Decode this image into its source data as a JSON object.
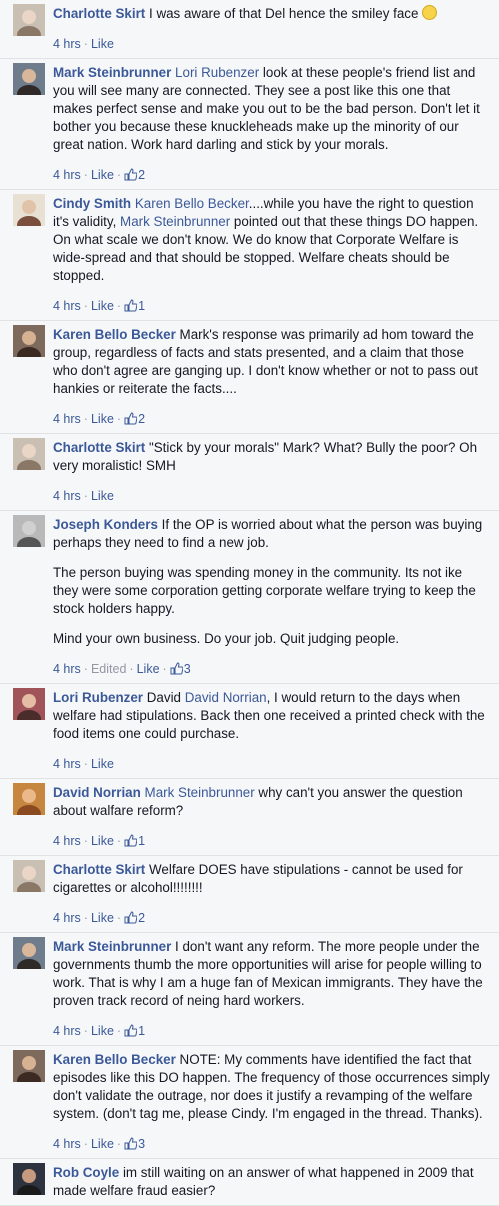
{
  "meta_labels": {
    "like": "Like",
    "separator": "·"
  },
  "comments": [
    {
      "author": "Charlotte Skirt",
      "avatar": "charlotte-avatar",
      "segments": [
        {
          "t": "text",
          "v": "I was aware of that Del hence the smiley face "
        },
        {
          "t": "emoji",
          "v": "smiley"
        }
      ],
      "time": "4 hrs",
      "edited": null,
      "likes": null
    },
    {
      "author": "Mark Steinbrunner",
      "avatar": "mark-avatar",
      "segments": [
        {
          "t": "mention",
          "v": "Lori Rubenzer"
        },
        {
          "t": "text",
          "v": " look at these people's friend list and you will see many are connected. They see a post like this one that makes perfect sense and make you out to be the bad person. Don't let it bother you because these knuckleheads make up the minority of our great nation. Work hard darling and stick by your morals."
        }
      ],
      "time": "4 hrs",
      "edited": null,
      "likes": "2"
    },
    {
      "author": "Cindy Smith",
      "avatar": "cindy-avatar",
      "segments": [
        {
          "t": "mention",
          "v": "Karen Bello Becker"
        },
        {
          "t": "text",
          "v": "....while you have the right to question it's validity, "
        },
        {
          "t": "mention",
          "v": "Mark Steinbrunner"
        },
        {
          "t": "text",
          "v": " pointed out that these things DO happen. On what scale we don't know. We do know that Corporate Welfare is wide-spread and that should be stopped. Welfare cheats should be stopped."
        }
      ],
      "time": "4 hrs",
      "edited": null,
      "likes": "1"
    },
    {
      "author": "Karen Bello Becker",
      "avatar": "karen-avatar",
      "segments": [
        {
          "t": "text",
          "v": "Mark's response was primarily ad hom toward the group, regardless of facts and stats presented, and a claim that those who don't agree are ganging up. I don't know whether or not to pass out hankies or reiterate the facts...."
        }
      ],
      "time": "4 hrs",
      "edited": null,
      "likes": "2"
    },
    {
      "author": "Charlotte Skirt",
      "avatar": "charlotte-avatar",
      "segments": [
        {
          "t": "text",
          "v": "\"Stick by your morals\" Mark? What? Bully the poor? Oh very moralistic! SMH"
        }
      ],
      "time": "4 hrs",
      "edited": null,
      "likes": null
    },
    {
      "author": "Joseph Konders",
      "avatar": "joseph-avatar",
      "segments": [
        {
          "t": "text",
          "v": "If the OP is worried about what the person was buying perhaps they need to find a new job."
        }
      ],
      "extra_paragraphs": [
        "The person buying was spending money in the community. Its not ike they were some corporation getting corporate welfare trying to keep the stock holders happy.",
        "Mind your own business. Do your job. Quit judging people."
      ],
      "time": "4 hrs",
      "edited": "Edited",
      "likes": "3"
    },
    {
      "author": "Lori Rubenzer",
      "avatar": "lori-avatar",
      "segments": [
        {
          "t": "text",
          "v": "David "
        },
        {
          "t": "mention",
          "v": "David Norrian"
        },
        {
          "t": "text",
          "v": ", I would return to the days when welfare had stipulations. Back then one received a printed check with the food items one could purchase."
        }
      ],
      "time": "4 hrs",
      "edited": null,
      "likes": null
    },
    {
      "author": "David Norrian",
      "avatar": "david-avatar",
      "segments": [
        {
          "t": "mention",
          "v": "Mark Steinbrunner"
        },
        {
          "t": "text",
          "v": " why can't you answer the question about walfare reform?"
        }
      ],
      "time": "4 hrs",
      "edited": null,
      "likes": "1"
    },
    {
      "author": "Charlotte Skirt",
      "avatar": "charlotte-avatar",
      "segments": [
        {
          "t": "text",
          "v": "Welfare DOES have stipulations - cannot be used for cigarettes or alcohol!!!!!!!!"
        }
      ],
      "time": "4 hrs",
      "edited": null,
      "likes": "2"
    },
    {
      "author": "Mark Steinbrunner",
      "avatar": "mark-avatar",
      "segments": [
        {
          "t": "text",
          "v": "I don't want any reform. The more people under the governments thumb the more opportunities will arise for people willing to work. That is why I am a huge fan of Mexican immigrants. They have the proven track record of neing hard workers."
        }
      ],
      "time": "4 hrs",
      "edited": null,
      "likes": "1"
    },
    {
      "author": "Karen Bello Becker",
      "avatar": "karen-avatar",
      "segments": [
        {
          "t": "text",
          "v": "NOTE: My comments have identified the fact that episodes like this DO happen. The frequency of those occurrences simply don't validate the outrage, nor does it justify a revamping of the welfare system. (don't tag me, please Cindy. I'm engaged in the thread. Thanks)."
        }
      ],
      "time": "4 hrs",
      "edited": null,
      "likes": "3"
    },
    {
      "author": "Rob Coyle",
      "avatar": "rob-avatar",
      "segments": [
        {
          "t": "text",
          "v": "im still waiting on an answer of what happened in 2009 that made welfare fraud easier?"
        }
      ],
      "time": "",
      "edited": null,
      "likes": null
    }
  ]
}
